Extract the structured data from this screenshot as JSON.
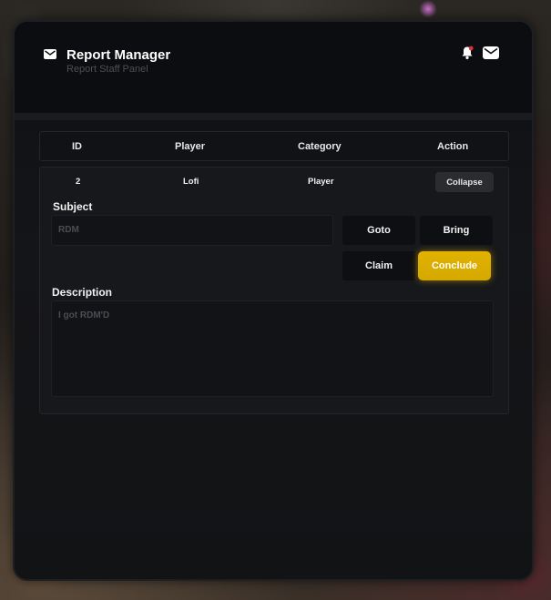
{
  "header": {
    "title": "Report Manager",
    "subtitle": "Report Staff Panel"
  },
  "table": {
    "columns": [
      "ID",
      "Player",
      "Category",
      "Action"
    ]
  },
  "report": {
    "id": "2",
    "player": "Lofi",
    "category": "Player",
    "collapse_label": "Collapse",
    "subject_label": "Subject",
    "subject_value": "RDM",
    "description_label": "Description",
    "description_value": "I got RDM'D",
    "buttons": {
      "goto": "Goto",
      "bring": "Bring",
      "claim": "Claim",
      "conclude": "Conclude"
    }
  },
  "colors": {
    "accent": "#d9ad00",
    "notification_dot": "#e0303a",
    "panel_bg": "#121315"
  },
  "icons": [
    "mail-icon",
    "bell-icon",
    "mail-icon"
  ]
}
